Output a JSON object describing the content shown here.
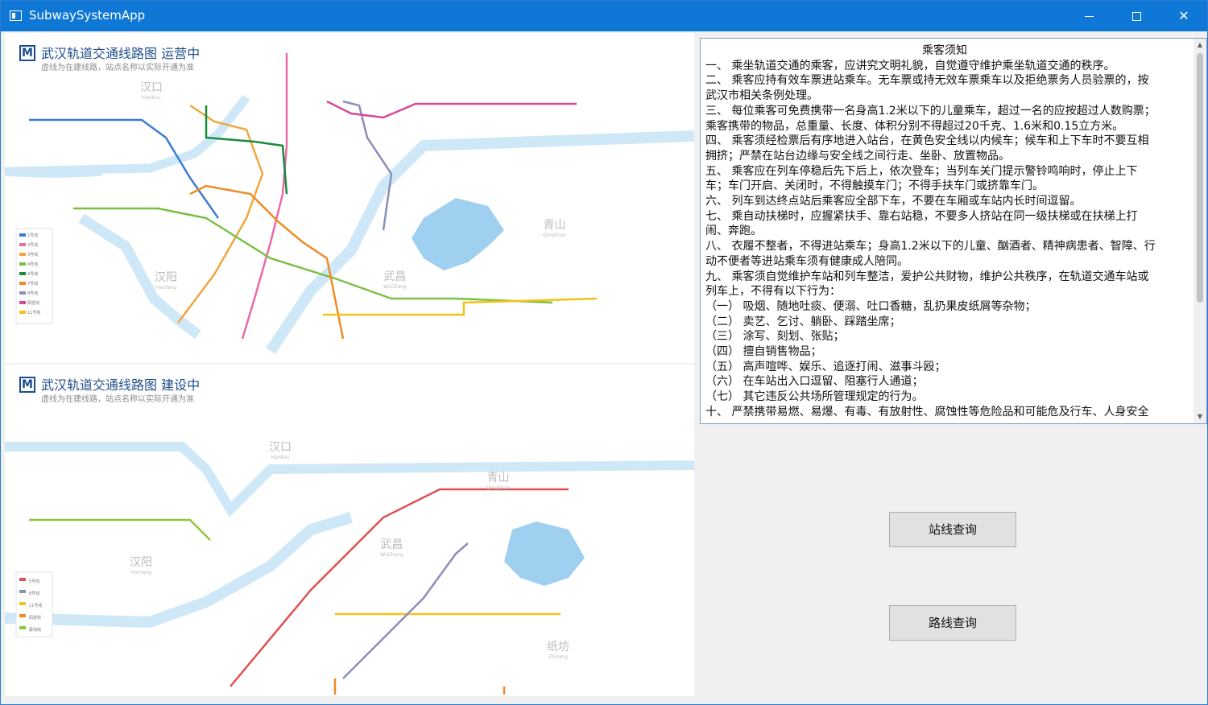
{
  "window": {
    "title": "SubwaySystemApp"
  },
  "map_operating": {
    "logo": "M",
    "title": "武汉轨道交通线路图  运营中",
    "subtitle": "虚线为在建线路，站点名称以实际开通为准",
    "districts": [
      {
        "zh": "汉口",
        "en": "HanKou"
      },
      {
        "zh": "汉阳",
        "en": "HanYang"
      },
      {
        "zh": "武昌",
        "en": "WuChang"
      },
      {
        "zh": "青山",
        "en": "QingShan"
      }
    ],
    "legend": [
      "1号线",
      "2号线",
      "3号线",
      "4号线",
      "6号线",
      "7号线",
      "8号线",
      "阳逻线",
      "11号线"
    ],
    "line_colors": [
      "#3a7bd5",
      "#e86aa6",
      "#f0a640",
      "#78c043",
      "#1a8a3c",
      "#f08a24",
      "#8b8fb8",
      "#d44a9a",
      "#f2c21b"
    ]
  },
  "map_construction": {
    "logo": "M",
    "title": "武汉轨道交通线路图  建设中",
    "subtitle": "虚线为在建线路，站点名称以实际开通为准",
    "districts": [
      {
        "zh": "汉口",
        "en": "HanKou"
      },
      {
        "zh": "汉阳",
        "en": "HanYang"
      },
      {
        "zh": "武昌",
        "en": "WuChang"
      },
      {
        "zh": "青山",
        "en": "QingShan"
      },
      {
        "zh": "纸坊",
        "en": "ZhiFang"
      }
    ],
    "legend": [
      "5号线",
      "8号线",
      "11号线",
      "阳逻线",
      "蔡甸线"
    ],
    "line_colors": [
      "#e05050",
      "#8b8fb8",
      "#f2c21b",
      "#f08a24",
      "#8cc63f"
    ]
  },
  "notice": {
    "title": "乘客须知",
    "lines": [
      "一、  乘坐轨道交通的乘客，应讲究文明礼貌，自觉遵守维护乘坐轨道交通的秩序。",
      "二、  乘客应持有效车票进站乘车。无车票或持无效车票乘车以及拒绝票务人员验票的，按",
      "武汉市相关条例处理。",
      "三、  每位乘客可免费携带一名身高1.2米以下的儿童乘车，超过一名的应按超过人数购票；",
      "乘客携带的物品，总重量、长度、体积分别不得超过20千克、1.6米和0.15立方米。",
      "四、  乘客须经检票后有序地进入站台，在黄色安全线以内候车；候车和上下车时不要互相",
      "拥挤；严禁在站台边缘与安全线之间行走、坐卧、放置物品。",
      "五、  乘客应在列车停稳后先下后上，依次登车；当列车关门提示警铃鸣响时，停止上下",
      "车；车门开启、关闭时，不得触摸车门；不得手扶车门或挤靠车门。",
      "六、  列车到达终点站后乘客应全部下车，不要在车厢或车站内长时间逗留。",
      "七、  乘自动扶梯时，应握紧扶手、靠右站稳，不要多人挤站在同一级扶梯或在扶梯上打",
      "闹、奔跑。",
      "八、  衣履不整者，不得进站乘车；身高1.2米以下的儿童、酗酒者、精神病患者、智障、行",
      "动不便者等进站乘车须有健康成人陪同。",
      "九、  乘客须自觉维护车站和列车整洁，爱护公共财物，维护公共秩序，在轨道交通车站或",
      "列车上，不得有以下行为：",
      "（一）  吸烟、随地吐痰、便溺、吐口香糖，乱扔果皮纸屑等杂物；",
      "（二）  卖艺、乞讨、躺卧、踩踏坐席；",
      "（三）  涂写、刻划、张贴；",
      "（四）  擅自销售物品；",
      "（五）  高声喧哗、娱乐、追逐打闹、滋事斗殴；",
      "（六）  在车站出入口逗留、阻塞行人通道；",
      "（七）  其它违反公共场所管理规定的行为。",
      "十、  严禁携带易燃、易爆、有毒、有放射性、腐蚀性等危险品和可能危及行车、人身安全"
    ]
  },
  "buttons": {
    "station_query": "站线查询",
    "route_query": "路线查询"
  }
}
